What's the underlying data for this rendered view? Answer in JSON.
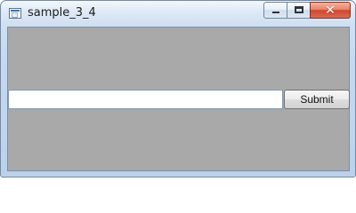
{
  "window": {
    "title": "sample_3_4",
    "icon": "application-window-icon",
    "controls": {
      "minimize_icon": "minimize-icon",
      "maximize_icon": "maximize-icon",
      "close_icon": "close-icon",
      "close_symbol": "✕"
    }
  },
  "form": {
    "input_value": "",
    "input_placeholder": "",
    "submit_label": "Submit"
  },
  "colors": {
    "client_background": "#a9a9a9",
    "titlebar_background": "#c7d9ee",
    "close_button": "#cf4732"
  }
}
